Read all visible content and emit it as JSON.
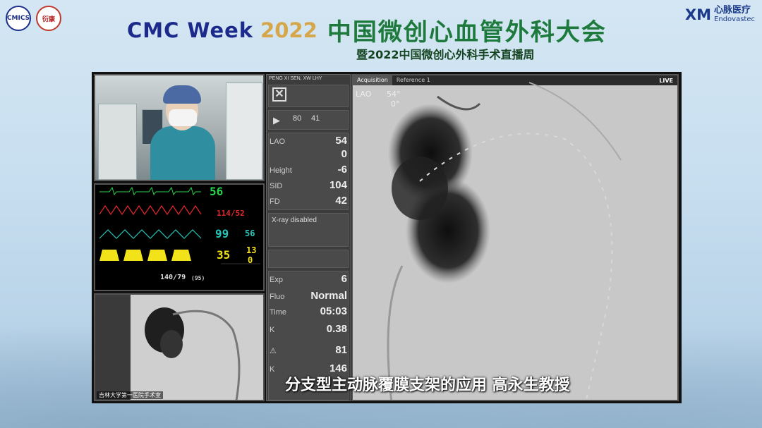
{
  "header": {
    "brand": "CMC Week",
    "year": "2022",
    "conference": "中国微创心血管外科大会",
    "subtitle": "暨2022中国微创心外科手术直播周",
    "logo1_text": "CMICS",
    "logo2_text": "衍康"
  },
  "sponsor": {
    "mark": "XM",
    "name_cn": "心脉医疗",
    "name_en": "Endovastec"
  },
  "monitor": {
    "hr": "56",
    "bp": "114/52",
    "spo2": "99",
    "spo2_right": "56",
    "etco2": "35",
    "val_13": "13",
    "val_0": "0",
    "nibp": "140/79",
    "nibp_sub": "(95)"
  },
  "panel": {
    "names": "PENG XI SEN, XW LHY",
    "pulse_rate": "80",
    "pulse_unit": "41",
    "lao_label": "LAO",
    "lao_value": "54",
    "lao_sub": "0",
    "height_label": "Height",
    "height_value": "-6",
    "sid_label": "SID",
    "sid_value": "104",
    "fd_label": "FD",
    "fd_value": "42",
    "xray_status": "X-ray disabled",
    "exp_label": "Exp",
    "exp_value": "6",
    "fluo_label": "Fluo",
    "fluo_value": "Normal",
    "time_label": "Time",
    "time_value": "05:03",
    "k_value1": "0.38",
    "k_value2": "81",
    "k_value3": "146"
  },
  "fluoro": {
    "tab_acquisition": "Acquisition",
    "tab_reference": "Reference 1",
    "live": "LIVE",
    "angle_label": "LAO",
    "angle_value": "54°",
    "angle_sub": "0°"
  },
  "small_view": {
    "label": "吉林大学第一医院手术室"
  },
  "caption": "分支型主动脉覆膜支架的应用 高永生教授"
}
